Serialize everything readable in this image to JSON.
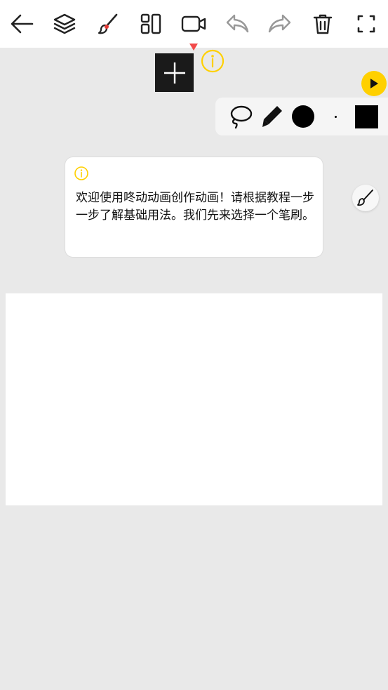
{
  "toolbar": {
    "buttons": [
      {
        "name": "back-button",
        "icon": "arrow-left-icon"
      },
      {
        "name": "layers-button",
        "icon": "layers-icon"
      },
      {
        "name": "brush-tool-button",
        "icon": "brush-icon"
      },
      {
        "name": "layout-button",
        "icon": "layout-icon"
      },
      {
        "name": "video-button",
        "icon": "video-camera-icon"
      },
      {
        "name": "undo-button",
        "icon": "undo-icon"
      },
      {
        "name": "redo-button",
        "icon": "redo-icon"
      },
      {
        "name": "delete-button",
        "icon": "trash-icon"
      },
      {
        "name": "fullscreen-button",
        "icon": "expand-corners-icon"
      }
    ]
  },
  "timeline": {
    "add_frame_icon": "plus-icon",
    "marker_color": "#f24a4a",
    "info_icon": "info-icon",
    "info_color": "#ffd000"
  },
  "play": {
    "icon": "play-icon",
    "color": "#ffd000"
  },
  "brush_panel": {
    "items": [
      "lasso-icon",
      "pencil-icon",
      "color-swatch-circle",
      "brush-size-dot",
      "color-square"
    ]
  },
  "tip": {
    "icon": "info-icon",
    "text": "欢迎使用咚动动画创作动画！请根据教程一步一步了解基础用法。我们先来选择一个笔刷。"
  },
  "brush_fab": {
    "icon": "brush-icon"
  },
  "colors": {
    "background": "#e9e9e9",
    "toolbar": "#ffffff",
    "canvas": "#ffffff",
    "accent": "#ffd000"
  }
}
